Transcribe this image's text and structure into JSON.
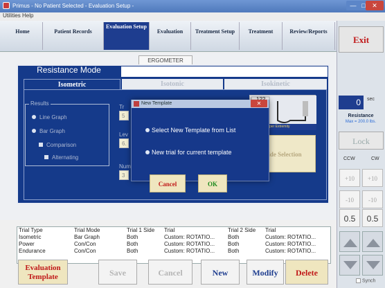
{
  "window": {
    "title": "Primus - No Patient Selected - Evaluation Setup -",
    "menu": "Utilities Help",
    "min": "—",
    "max": "□",
    "close": "✕"
  },
  "nav": {
    "tabs": [
      "Home",
      "Patient Records",
      "Evaluation Setup",
      "Evaluation",
      "Treatment Setup",
      "Treatment",
      "Review/Reports"
    ],
    "active_index": 2
  },
  "exit_label": "Exit",
  "ergometer": "ERGOMETER",
  "resistance_mode": {
    "title": "Resistance Mode",
    "tabs": [
      "Isometric",
      "Isotonic",
      "Isokinetic"
    ]
  },
  "results": {
    "label": "Results",
    "options": [
      "Line Graph",
      "Bar Graph",
      "Comparison",
      "Alternating"
    ]
  },
  "background_fields": {
    "tr_label": "Tr",
    "tr_value": "5",
    "lev_label": "Lev",
    "lev_value": "6.",
    "num_label": "Num",
    "num_value": "3",
    "img_num": "122",
    "img_caption": "Custom Upper Extremity",
    "side_selection": "Side Selection"
  },
  "modal": {
    "title": "New Template",
    "close": "✕",
    "option1": "Select New Template from List",
    "option2": "New trial for current template",
    "cancel": "Cancel",
    "ok": "OK"
  },
  "table": {
    "headers": [
      "Trial Type",
      "Trial Mode",
      "Trial 1 Side",
      "Trial",
      "Trial 2 Side",
      "Trial"
    ],
    "rows": [
      [
        "Isometric",
        "Bar Graph",
        "Both",
        "Custom: ROTATIO...",
        "Both",
        "Custom: ROTATIO..."
      ],
      [
        "Power",
        "Con/Con",
        "Both",
        "Custom: ROTATIO...",
        "Both",
        "Custom: ROTATIO..."
      ],
      [
        "Endurance",
        "Con/Con",
        "Both",
        "Custom: ROTATIO...",
        "Both",
        "Custom: ROTATIO..."
      ]
    ]
  },
  "buttons": {
    "eval_line1": "Evaluation",
    "eval_line2": "Template",
    "save": "Save",
    "cancel": "Cancel",
    "new": "New",
    "modify": "Modify",
    "delete": "Delete"
  },
  "right_panel": {
    "sec_value": "0",
    "sec_unit": "sec",
    "resistance": "Resistance",
    "max": "Max = 200.0 lbs.",
    "lock": "Lock",
    "ccw": "CCW",
    "cw": "CW",
    "plus10": "+10",
    "minus10": "-10",
    "val_ccw": "0.5",
    "val_cw": "0.5",
    "synch": "Synch"
  },
  "colors": {
    "accent_blue": "#153a8a",
    "danger_red": "#c01818",
    "ok_green": "#1e8b1e",
    "button_cream": "#efe6bf"
  }
}
